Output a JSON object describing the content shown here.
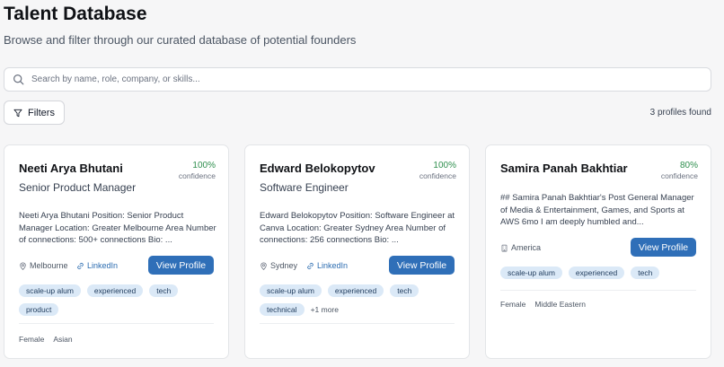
{
  "header": {
    "title": "Talent Database",
    "subtitle": "Browse and filter through our curated database of potential founders"
  },
  "search": {
    "placeholder": "Search by name, role, company, or skills..."
  },
  "toolbar": {
    "filters_label": "Filters",
    "profiles_count": "3 profiles found"
  },
  "profiles": [
    {
      "name": "Neeti Arya Bhutani",
      "role": "Senior Product Manager",
      "confidence": "100%",
      "confidence_label": "confidence",
      "description": "Neeti Arya Bhutani Position: Senior Product Manager Location: Greater Melbourne Area Number of connections: 500+ connections Bio: ...",
      "location": "Melbourne",
      "linkedin": "LinkedIn",
      "view_label": "View Profile",
      "tags": [
        "scale-up alum",
        "experienced",
        "tech",
        "product"
      ],
      "more": "",
      "gender": "Female",
      "ethnicity": "Asian"
    },
    {
      "name": "Edward Belokopytov",
      "role": "Software Engineer",
      "confidence": "100%",
      "confidence_label": "confidence",
      "description": "Edward Belokopytov Position: Software Engineer at Canva Location: Greater Sydney Area Number of connections: 256 connections Bio: ...",
      "location": "Sydney",
      "linkedin": "LinkedIn",
      "view_label": "View Profile",
      "tags": [
        "scale-up alum",
        "experienced",
        "tech",
        "technical"
      ],
      "more": "+1 more",
      "gender": "",
      "ethnicity": ""
    },
    {
      "name": "Samira Panah Bakhtiar",
      "role": "",
      "confidence": "80%",
      "confidence_label": "confidence",
      "description": "## Samira Panah Bakhtiar's Post General Manager of Media & Entertainment, Games, and Sports at AWS 6mo I am deeply humbled and...",
      "location": "America",
      "linkedin": "",
      "view_label": "View Profile",
      "tags": [
        "scale-up alum",
        "experienced",
        "tech"
      ],
      "more": "",
      "gender": "Female",
      "ethnicity": "Middle Eastern"
    }
  ],
  "colors": {
    "accent": "#2f6fb8",
    "confidence": "#2f8f4e",
    "tag_bg": "#dbe9f7"
  }
}
